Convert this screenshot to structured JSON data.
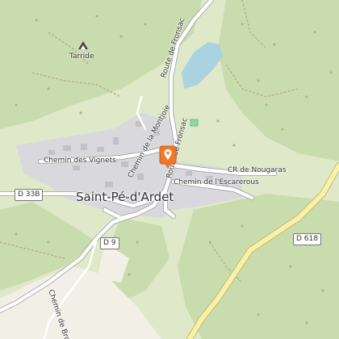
{
  "labels": {
    "tarride": "Tarride",
    "town": "Saint-Pé-d'Ardet",
    "route_fronsac": "Route de Fronsac",
    "route_fronsac_2": "Route de Fronsac",
    "chemin_montjoie": "Chemin de la Montjoie",
    "chemin_vignets": "Chemin des Vignets",
    "cr_nougaras": "CR de Nougaras",
    "chemin_escarerous": "Chemin de l'Escarerous",
    "chemin_broscas": "Chemin de Brosc"
  },
  "shields": {
    "d33b": "D 33B",
    "d9": "D 9",
    "d618": "D 618"
  },
  "colors": {
    "forest": "#c9dcae",
    "meadow": "#dfe8c9",
    "field": "#f2efe6",
    "village": "#d8d8dd",
    "water": "#aad3df",
    "road_major": "#f7f2a5",
    "marker": "#f07828"
  },
  "icons": {
    "marker": "map-pin-icon",
    "peak": "peak-icon"
  }
}
